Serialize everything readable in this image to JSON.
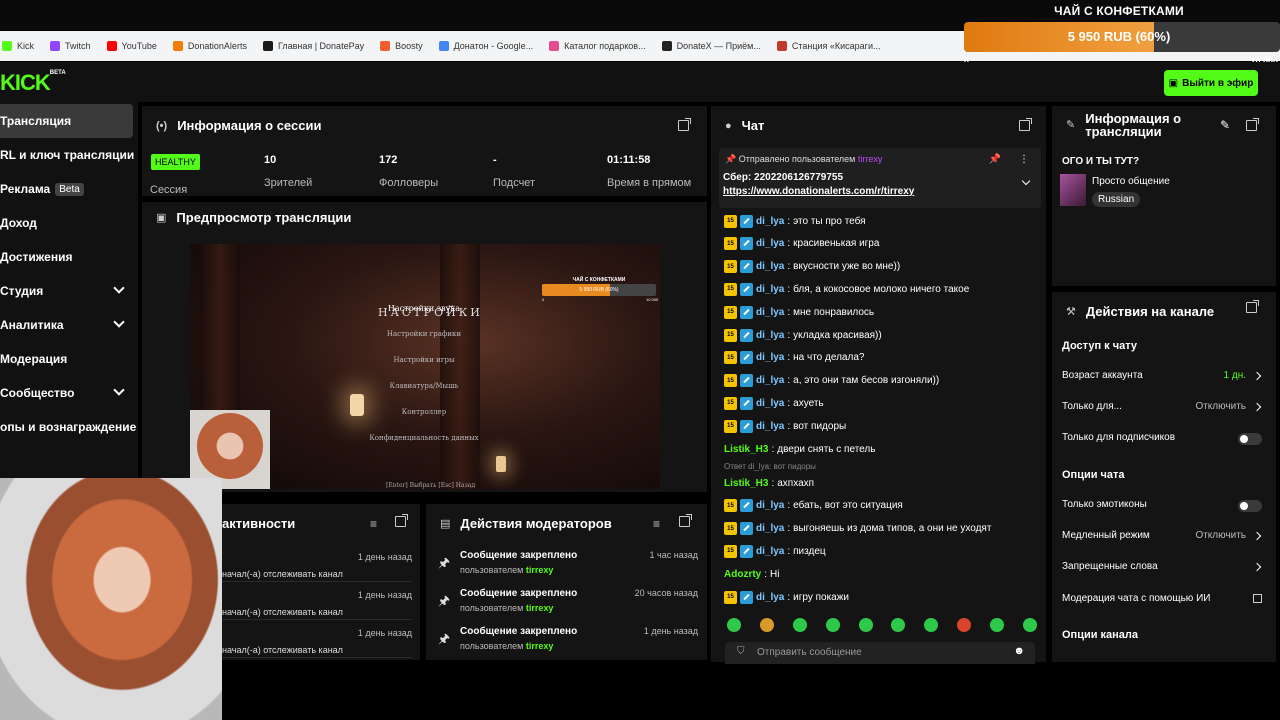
{
  "bookmarks": [
    {
      "label": "Kick",
      "color": "#53fc18"
    },
    {
      "label": "Twitch",
      "color": "#9146ff"
    },
    {
      "label": "YouTube",
      "color": "#ff0000"
    },
    {
      "label": "DonationAlerts",
      "color": "#f57d07"
    },
    {
      "label": "Главная | DonatePay",
      "color": "#1b1b1b"
    },
    {
      "label": "Boosty",
      "color": "#f15f2c"
    },
    {
      "label": "Донатон - Google...",
      "color": "#4285f4"
    },
    {
      "label": "Каталог подарков...",
      "color": "#e44c8f"
    },
    {
      "label": "DonateX — Приём...",
      "color": "#222222"
    },
    {
      "label": "Станция «Кисараги...",
      "color": "#c0392b"
    }
  ],
  "goal": {
    "title": "ЧАЙ С КОНФЕТКАМИ",
    "text": "5 950 RUB (60%)",
    "progress": 0.6,
    "min": "0",
    "max": "10 000"
  },
  "header": {
    "logo": "KICK",
    "logo_sup": "BETA",
    "go_live": "Выйти в эфир"
  },
  "sidebar": {
    "items": [
      {
        "label": "Трансляция",
        "active": true
      },
      {
        "label": "RL и ключ трансляции"
      },
      {
        "label": "Реклама",
        "badge": "Beta"
      },
      {
        "label": "Доход"
      },
      {
        "label": "Достижения"
      },
      {
        "label": "Студия",
        "chevron": true
      },
      {
        "label": "Аналитика",
        "chevron": true
      },
      {
        "label": "Модерация"
      },
      {
        "label": "Сообщество",
        "chevron": true
      },
      {
        "label": "опы и вознаграждение"
      }
    ]
  },
  "session": {
    "title": "Информация о сессии",
    "health": "HEALTHY",
    "health_label": "Сессия",
    "stats": [
      {
        "value": "10",
        "label": "Зрителей"
      },
      {
        "value": "172",
        "label": "Фолловеры"
      },
      {
        "value": "-",
        "label": "Подсчет"
      },
      {
        "value": "01:11:58",
        "label": "Время в прямом"
      }
    ]
  },
  "preview": {
    "title": "Предпросмотр трансляции",
    "game_title": "НАСТРОЙКИ",
    "game_menu": [
      "Настройки звука",
      "Настройки графики",
      "Настройки игры",
      "Клавиатура/Мышь",
      "Контроллер",
      "Конфиденциальность данных"
    ],
    "game_hint": "[Enter] Выбрать      [Esc] Назад",
    "mini_goal": {
      "title": "ЧАЙ С КОНФЕТКАМИ",
      "text": "5 950 RUB (60%)",
      "progress": 0.6,
      "min": "0",
      "max": "10 000"
    }
  },
  "activity": {
    "title": "активности",
    "rows": [
      {
        "time": "1 день назад",
        "text": "начал(-а) отслеживать канал"
      },
      {
        "time": "1 день назад",
        "text": "начал(-а) отслеживать канал"
      },
      {
        "time": "1 день назад",
        "text": "начал(-а) отслеживать канал"
      }
    ]
  },
  "modact": {
    "title": "Действия модераторов",
    "rows": [
      {
        "head": "Сообщение закреплено",
        "sub": "пользователем",
        "user": "tirrexy",
        "time": "1 час назад"
      },
      {
        "head": "Сообщение закреплено",
        "sub": "пользователем",
        "user": "tirrexy",
        "time": "20 часов назад"
      },
      {
        "head": "Сообщение закреплено",
        "sub": "пользователем",
        "user": "tirrexy",
        "time": "1 день назад"
      }
    ]
  },
  "chat": {
    "title": "Чат",
    "pinned": {
      "head": "Отправлено пользователем",
      "user": "tirrexy",
      "line1": "Сбер: 2202206126779755",
      "line2": "https://www.donationalerts.com/r/tirrexy"
    },
    "messages": [
      {
        "user": "di_lya",
        "text": "это ты про тебя",
        "badges": true
      },
      {
        "user": "di_lya",
        "text": "красивенькая игра",
        "badges": true
      },
      {
        "user": "di_lya",
        "text": "вкусности уже во мне))",
        "badges": true
      },
      {
        "user": "di_lya",
        "text": "бля, а кокосовое молоко ничего такое",
        "badges": true
      },
      {
        "user": "di_lya",
        "text": "мне понравилось",
        "badges": true
      },
      {
        "user": "di_lya",
        "text": "укладка красивая))",
        "badges": true
      },
      {
        "user": "di_lya",
        "text": "на что делала?",
        "badges": true
      },
      {
        "user": "di_lya",
        "text": "а, это они там бесов изгоняли))",
        "badges": true
      },
      {
        "user": "di_lya",
        "text": "ахуеть",
        "badges": true
      },
      {
        "user": "di_lya",
        "text": "вот пидоры",
        "badges": true
      },
      {
        "user": "Listik_H3",
        "text": "двери снять с петель",
        "badges": false
      },
      {
        "user": "Listik_H3",
        "text": "ахпхахп",
        "badges": false,
        "reply": "Ответ di_lya: вот пидоры"
      },
      {
        "user": "di_lya",
        "text": "ебать, вот это ситуация",
        "badges": true
      },
      {
        "user": "di_lya",
        "text": "выгоняешь из дома типов, а они не уходят",
        "badges": true
      },
      {
        "user": "di_lya",
        "text": "пиздец",
        "badges": true
      },
      {
        "user": "Adozrty",
        "text": "Hi",
        "badges": false
      },
      {
        "user": "di_lya",
        "text": "игру покажи",
        "badges": true
      }
    ],
    "badge_text": "15",
    "input_placeholder": "Отправить сообщение"
  },
  "stream_info": {
    "title_l1": "Информация о",
    "title_l2": "трансляции",
    "stream_title": "ОГО И ТЫ ТУТ?",
    "category": "Просто общение",
    "language": "Russian"
  },
  "channel_actions": {
    "title": "Действия на канале",
    "chat_access": "Доступ к чату",
    "account_age": {
      "label": "Возраст аккаунта",
      "value": "1 дн."
    },
    "only_for": {
      "label": "Только для...",
      "value": "Отключить"
    },
    "subs_only": "Только для подписчиков",
    "chat_options": "Опции чата",
    "emotes_only": "Только эмотиконы",
    "slow_mode": {
      "label": "Медленный режим",
      "value": "Отключить"
    },
    "banned_words": "Запрещенные слова",
    "ai_mod": "Модерация чата с помощью ИИ",
    "channel_options": "Опции канала"
  }
}
